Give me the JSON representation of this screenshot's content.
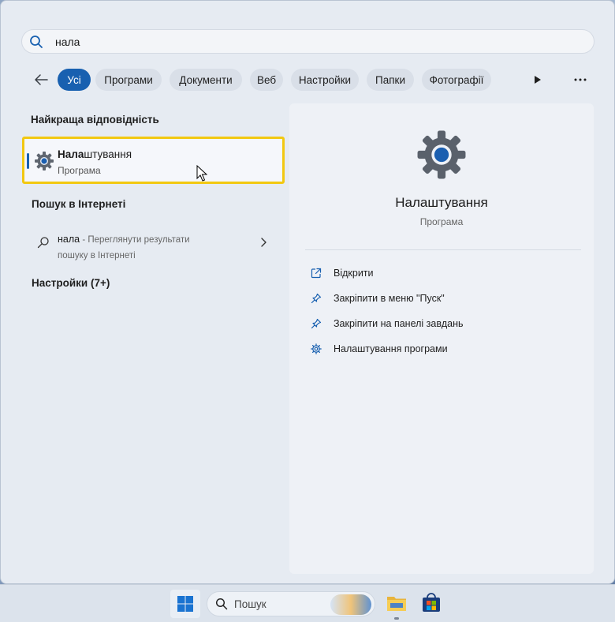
{
  "search": {
    "query": "нала",
    "placeholder": ""
  },
  "filters": {
    "back_icon": "arrow-left-icon",
    "tabs": [
      {
        "label": "Усі",
        "active": true
      },
      {
        "label": "Програми"
      },
      {
        "label": "Документи"
      },
      {
        "label": "Веб"
      },
      {
        "label": "Настройки"
      },
      {
        "label": "Папки"
      },
      {
        "label": "Фотографії"
      }
    ],
    "more_icon": "play-icon",
    "overflow_icon": "ellipsis-icon"
  },
  "best_match": {
    "section_title": "Найкраща відповідність",
    "name_highlight": "Нала",
    "name_rest": "штування",
    "type": "Програма",
    "icon": "settings-gear-icon"
  },
  "web_search": {
    "section_title": "Пошук в Інтернеті",
    "query": "нала",
    "hint": "- Переглянути результати пошуку в Інтернеті"
  },
  "settings_section": {
    "title": "Настройки (7+)"
  },
  "preview": {
    "title": "Налаштування",
    "subtitle": "Програма",
    "actions": [
      {
        "label": "Відкрити",
        "icon": "open-external-icon"
      },
      {
        "label": "Закріпити в меню \"Пуск\"",
        "icon": "pin-icon"
      },
      {
        "label": "Закріпити на панелі завдань",
        "icon": "pin-icon"
      },
      {
        "label": "Налаштування програми",
        "icon": "gear-icon"
      }
    ]
  },
  "taskbar": {
    "search_placeholder": "Пошук",
    "items": [
      "start-icon",
      "file-explorer-icon",
      "store-icon"
    ]
  },
  "colors": {
    "accent": "#1860b0",
    "highlight": "#f2c811"
  }
}
